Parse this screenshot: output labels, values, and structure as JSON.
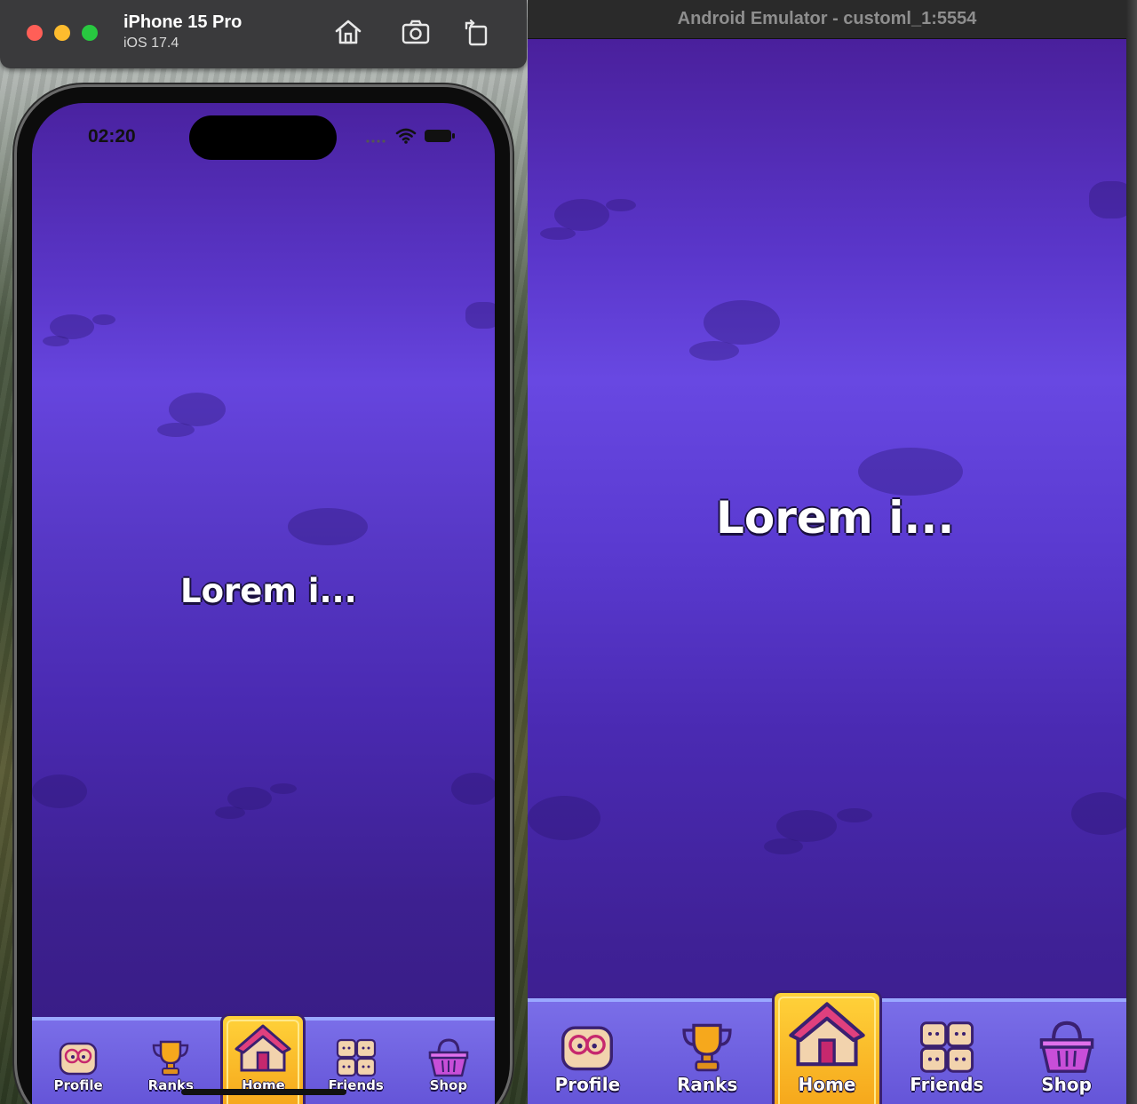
{
  "ios_simulator": {
    "device_name": "iPhone 15 Pro",
    "os_version": "iOS 17.4",
    "toolbar": {
      "home_icon": "home-icon",
      "screenshot_icon": "camera-icon",
      "rotate_icon": "rotate-icon"
    },
    "status_bar": {
      "time": "02:20",
      "signal": "signal-dots-icon",
      "wifi": "wifi-icon",
      "battery": "battery-icon"
    }
  },
  "android_emulator": {
    "window_title": "Android Emulator - customl_1:5554"
  },
  "app": {
    "center_text": "Lorem i...",
    "colors": {
      "background_top": "#4a209c",
      "background_mid": "#6848e2",
      "tabbar": "#6a5ade",
      "active_tab": "#ffd23a"
    },
    "tabs": [
      {
        "label": "Profile",
        "icon": "profile-face-icon",
        "active": false
      },
      {
        "label": "Ranks",
        "icon": "trophy-icon",
        "active": false
      },
      {
        "label": "Home",
        "icon": "house-icon",
        "active": true
      },
      {
        "label": "Friends",
        "icon": "friends-blocks-icon",
        "active": false
      },
      {
        "label": "Shop",
        "icon": "shop-basket-icon",
        "active": false
      }
    ]
  }
}
